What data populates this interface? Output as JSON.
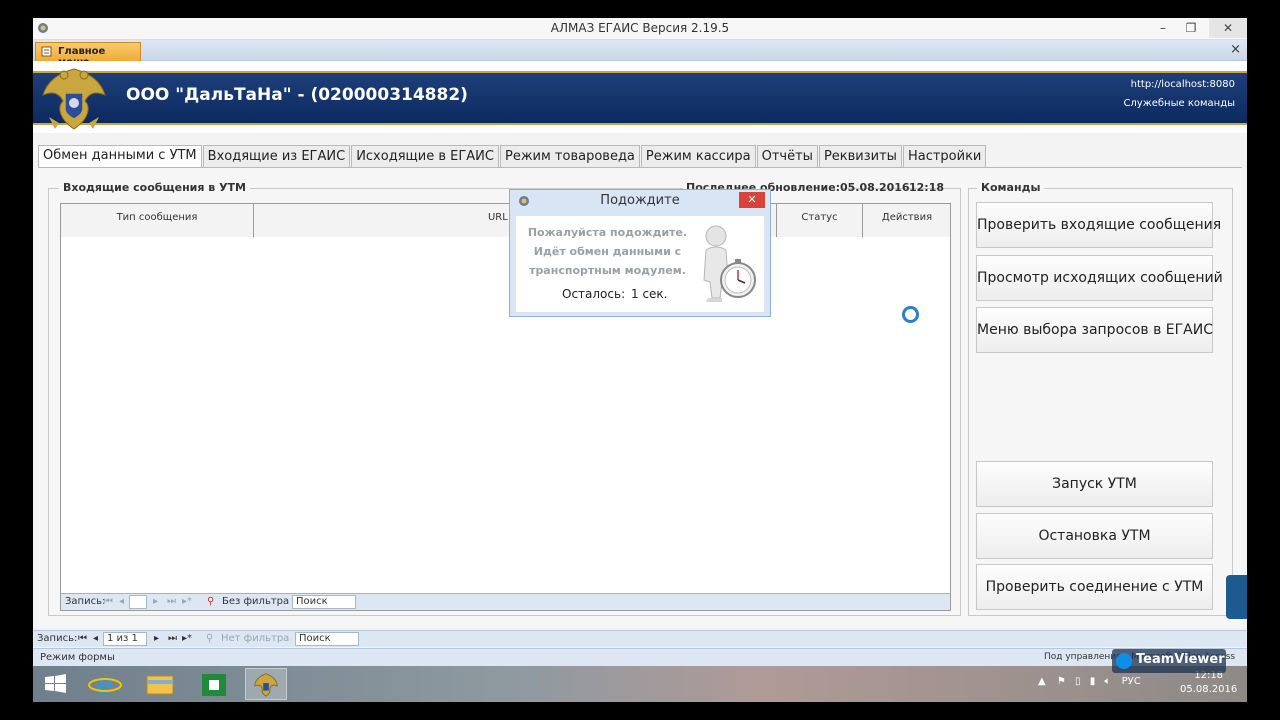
{
  "window": {
    "title": "АЛМАЗ ЕГАИС Версия 2.19.5",
    "minimize": "–",
    "restore": "❐",
    "close": "✕"
  },
  "doc_tab": {
    "label": "Главное меню",
    "close": "×"
  },
  "header": {
    "company": "ООО \"ДальТаНа\" - (020000314882)",
    "url": "http://localhost:8080",
    "service": "Служебные команды"
  },
  "tabs": [
    {
      "label": "Обмен данными с УТМ",
      "active": true
    },
    {
      "label": "Входящие из ЕГАИС"
    },
    {
      "label": "Исходящие в ЕГАИС"
    },
    {
      "label": "Режим товароведа"
    },
    {
      "label": "Режим кассира"
    },
    {
      "label": "Отчёты"
    },
    {
      "label": "Реквизиты"
    },
    {
      "label": "Настройки"
    }
  ],
  "incoming": {
    "legend": "Входящие сообщения в УТМ",
    "last_update_label": "Последнее обновление:",
    "last_update_date": "05.08.2016",
    "last_update_time": "12:18",
    "columns": [
      "Тип сообщения",
      "URL адрес",
      "Статус",
      "Действия"
    ],
    "nav": {
      "record": "Запись:",
      "first": "⏮",
      "prev": "◂",
      "next": "▸",
      "last": "⏭",
      "new": "▸*",
      "filter": "Без фильтра",
      "search": "Поиск"
    }
  },
  "commands": {
    "legend": "Команды",
    "buttons": [
      "Проверить входящие сообщения",
      "Просмотр исходящих сообщений",
      "Меню выбора запросов в ЕГАИС",
      "Запуск УТМ",
      "Остановка УТМ",
      "Проверить соединение с УТМ"
    ]
  },
  "dialog": {
    "title": "Подождите",
    "close": "✕",
    "line1": "Пожалуйста подождите.",
    "line2": "Идёт обмен данными с",
    "line3": "транспортным модулем.",
    "remaining_label": "Осталось:",
    "remaining_value": "1 сек."
  },
  "form_nav": {
    "record": "Запись:",
    "first": "⏮",
    "prev": "◂",
    "position": "1 из 1",
    "next": "▸",
    "last": "⏭",
    "new": "▸*",
    "filter": "Нет фильтра",
    "search": "Поиск"
  },
  "status": {
    "mode": "Режим формы",
    "right": "Под управлением Microsoft Office Access"
  },
  "teamviewer": {
    "label": "TeamViewer"
  },
  "taskbar": {
    "lang": "РУС",
    "time": "12:18",
    "date": "05.08.2016",
    "tray_up": "▲"
  },
  "colors": {
    "header_blue": "#0c2a60",
    "gold": "#c9a640",
    "nav_bar": "#dde7f3",
    "dialog_close": "#d9433a",
    "spinner": "#2b7fd3"
  }
}
